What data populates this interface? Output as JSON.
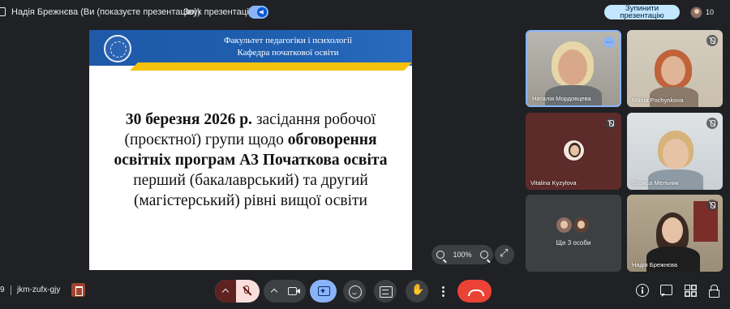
{
  "topbar": {
    "presenter": "Надія Брежнєва (Ви (показуєте презентацію))",
    "sound_label": "Звук презентації",
    "stop_button": "Зупинити презентацію",
    "participant_count": "10"
  },
  "slide": {
    "header_line1": "Факультет педагогіки і психології",
    "header_line2": "Кафедра початкової освіти",
    "body_date": "30 березня 2026 р.",
    "body_part1": " засідання робочої (проєктної) групи щодо ",
    "body_bold": "обговорення освітніх програм А3 Початкова освіта",
    "body_part2": " перший (бакалаврський) та другий (магістерський) рівні вищої освіти",
    "zoom_level": "100%"
  },
  "tiles": [
    {
      "name": "Наталія Мордовцева",
      "status": "speaking"
    },
    {
      "name": "Mariia Pochynkova",
      "status": "muted"
    },
    {
      "name": "Vitalina Kyzylova",
      "status": "muted"
    },
    {
      "name": "Лариса Мельник",
      "status": "muted"
    },
    {
      "more_label": "Ще 3 особи"
    },
    {
      "name": "Надія Брежнєва",
      "status": "muted"
    }
  ],
  "bottombar": {
    "time_fragment": "9",
    "meeting_code": "jkm-zufx-gjy"
  },
  "colors": {
    "background": "#202124",
    "accent": "#8ab4f8",
    "hangup": "#ea4335",
    "slide_blue": "#1e5aa8",
    "slide_yellow": "#f4c20d"
  },
  "icons": [
    "present-icon",
    "sound-toggle-icon",
    "mic-off-icon",
    "camera-icon",
    "present-screen-icon",
    "emoji-icon",
    "captions-icon",
    "raise-hand-icon",
    "more-options-icon",
    "hangup-icon",
    "info-icon",
    "chat-icon",
    "activities-icon",
    "host-controls-icon",
    "zoom-out-icon",
    "zoom-in-icon",
    "fullscreen-icon"
  ]
}
